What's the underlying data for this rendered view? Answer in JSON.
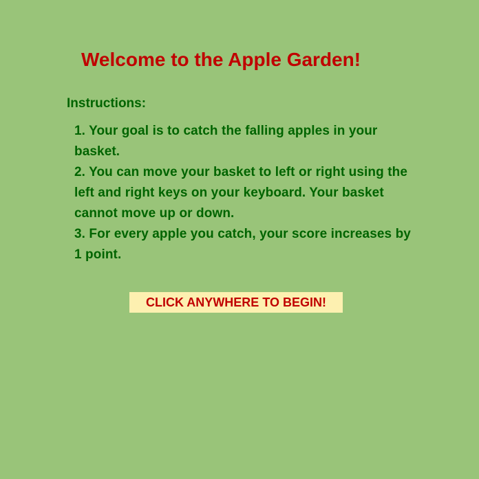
{
  "game": {
    "title": "Welcome to the Apple Garden!",
    "instructions_heading": "Instructions:",
    "instructions": [
      "1. Your goal is to catch the falling apples in your basket.",
      "2. You can move your basket to left or right using the left and right keys on your keyboard. Your basket cannot move up or down.",
      "3. For every apple you catch, your score increases by 1 point."
    ],
    "start_prompt": "CLICK ANYWHERE TO BEGIN!"
  },
  "colors": {
    "background": "#99c479",
    "title": "#c00000",
    "instructions_text": "#006400",
    "button_background": "#fdf0b0",
    "button_text": "#c00000"
  }
}
